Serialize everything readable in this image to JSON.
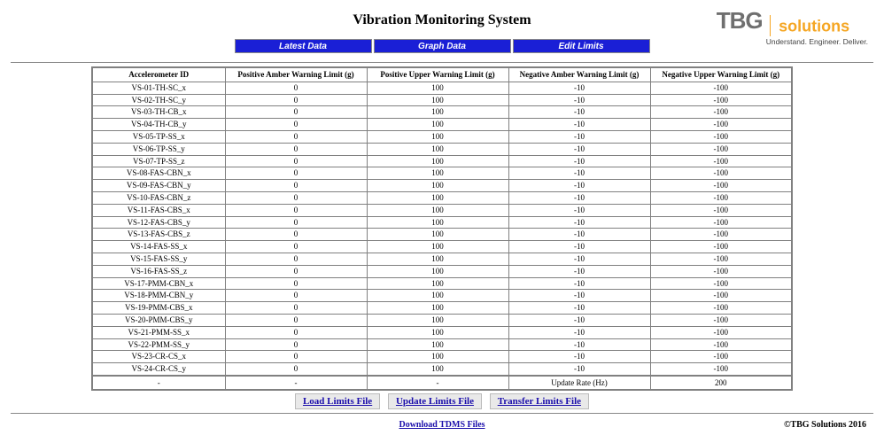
{
  "title": "Vibration Monitoring System",
  "logo": {
    "brand": "TBG",
    "sub": "solutions",
    "tagline": "Understand. Engineer. Deliver."
  },
  "nav": {
    "latest": "Latest Data",
    "graph": "Graph Data",
    "edit": "Edit Limits"
  },
  "columns": {
    "id": "Accelerometer ID",
    "pos_amber": "Positive Amber Warning Limit (g)",
    "pos_upper": "Positive Upper Warning Limit (g)",
    "neg_amber": "Negative Amber Warning Limit (g)",
    "neg_upper": "Negative Upper Warning Limit (g)"
  },
  "rows": [
    {
      "id": "VS-01-TH-SC_x",
      "pa": "0",
      "pu": "100",
      "na": "-10",
      "nu": "-100"
    },
    {
      "id": "VS-02-TH-SC_y",
      "pa": "0",
      "pu": "100",
      "na": "-10",
      "nu": "-100"
    },
    {
      "id": "VS-03-TH-CB_x",
      "pa": "0",
      "pu": "100",
      "na": "-10",
      "nu": "-100"
    },
    {
      "id": "VS-04-TH-CB_y",
      "pa": "0",
      "pu": "100",
      "na": "-10",
      "nu": "-100"
    },
    {
      "id": "VS-05-TP-SS_x",
      "pa": "0",
      "pu": "100",
      "na": "-10",
      "nu": "-100"
    },
    {
      "id": "VS-06-TP-SS_y",
      "pa": "0",
      "pu": "100",
      "na": "-10",
      "nu": "-100"
    },
    {
      "id": "VS-07-TP-SS_z",
      "pa": "0",
      "pu": "100",
      "na": "-10",
      "nu": "-100"
    },
    {
      "id": "VS-08-FAS-CBN_x",
      "pa": "0",
      "pu": "100",
      "na": "-10",
      "nu": "-100"
    },
    {
      "id": "VS-09-FAS-CBN_y",
      "pa": "0",
      "pu": "100",
      "na": "-10",
      "nu": "-100"
    },
    {
      "id": "VS-10-FAS-CBN_z",
      "pa": "0",
      "pu": "100",
      "na": "-10",
      "nu": "-100"
    },
    {
      "id": "VS-11-FAS-CBS_x",
      "pa": "0",
      "pu": "100",
      "na": "-10",
      "nu": "-100"
    },
    {
      "id": "VS-12-FAS-CBS_y",
      "pa": "0",
      "pu": "100",
      "na": "-10",
      "nu": "-100"
    },
    {
      "id": "VS-13-FAS-CBS_z",
      "pa": "0",
      "pu": "100",
      "na": "-10",
      "nu": "-100"
    },
    {
      "id": "VS-14-FAS-SS_x",
      "pa": "0",
      "pu": "100",
      "na": "-10",
      "nu": "-100"
    },
    {
      "id": "VS-15-FAS-SS_y",
      "pa": "0",
      "pu": "100",
      "na": "-10",
      "nu": "-100"
    },
    {
      "id": "VS-16-FAS-SS_z",
      "pa": "0",
      "pu": "100",
      "na": "-10",
      "nu": "-100"
    },
    {
      "id": "VS-17-PMM-CBN_x",
      "pa": "0",
      "pu": "100",
      "na": "-10",
      "nu": "-100"
    },
    {
      "id": "VS-18-PMM-CBN_y",
      "pa": "0",
      "pu": "100",
      "na": "-10",
      "nu": "-100"
    },
    {
      "id": "VS-19-PMM-CBS_x",
      "pa": "0",
      "pu": "100",
      "na": "-10",
      "nu": "-100"
    },
    {
      "id": "VS-20-PMM-CBS_y",
      "pa": "0",
      "pu": "100",
      "na": "-10",
      "nu": "-100"
    },
    {
      "id": "VS-21-PMM-SS_x",
      "pa": "0",
      "pu": "100",
      "na": "-10",
      "nu": "-100"
    },
    {
      "id": "VS-22-PMM-SS_y",
      "pa": "0",
      "pu": "100",
      "na": "-10",
      "nu": "-100"
    },
    {
      "id": "VS-23-CR-CS_x",
      "pa": "0",
      "pu": "100",
      "na": "-10",
      "nu": "-100"
    },
    {
      "id": "VS-24-CR-CS_y",
      "pa": "0",
      "pu": "100",
      "na": "-10",
      "nu": "-100"
    }
  ],
  "footer_row": {
    "c0": "-",
    "c1": "-",
    "c2": "-",
    "c3": "Update Rate (Hz)",
    "c4": "200"
  },
  "actions": {
    "load": "Load Limits File",
    "update": "Update Limits File",
    "transfer": "Transfer Limits File"
  },
  "bottom": {
    "download": "Download TDMS Files",
    "copyright": "©TBG Solutions 2016"
  }
}
